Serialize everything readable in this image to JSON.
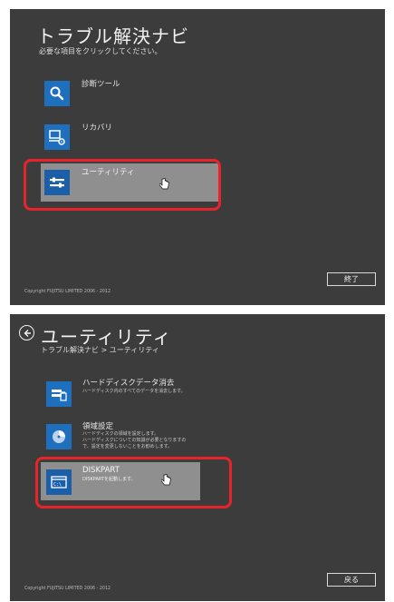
{
  "screen1": {
    "title": "トラブル解決ナビ",
    "subtitle": "必要な項目をクリックしてください。",
    "items": [
      {
        "label": "診断ツール",
        "icon": "search-icon"
      },
      {
        "label": "リカバリ",
        "icon": "computer-gear-icon"
      },
      {
        "label": "ユーティリティ",
        "icon": "tools-icon"
      }
    ],
    "exit_label": "終了",
    "copyright": "Copyright FUJITSU LIMITED 2006 - 2012"
  },
  "screen2": {
    "title": "ユーティリティ",
    "breadcrumb": "トラブル解決ナビ > ユーティリティ",
    "items": [
      {
        "label": "ハードディスクデータ消去",
        "desc": [
          "ハードディスク内のすべてのデータを消去します。"
        ],
        "icon": "disk-erase-icon"
      },
      {
        "label": "領域設定",
        "desc": [
          "ハードディスクの領域を設定します。",
          "ハードディスクについての知識が必要となりますの",
          "で、設定を変更しないことをお勧めします。"
        ],
        "icon": "disk-partition-icon"
      },
      {
        "label": "DISKPART",
        "desc": [
          "DISKPARTを起動します。"
        ],
        "icon": "command-window-icon"
      }
    ],
    "back_label": "戻る",
    "copyright": "Copyright FUJITSU LIMITED 2006 - 2012"
  },
  "colors": {
    "panel_bg": "#3c3c3c",
    "tile_blue": "#1f6fbf",
    "selected_row": "#8f8f8f",
    "annotation_red": "#e8232a"
  }
}
